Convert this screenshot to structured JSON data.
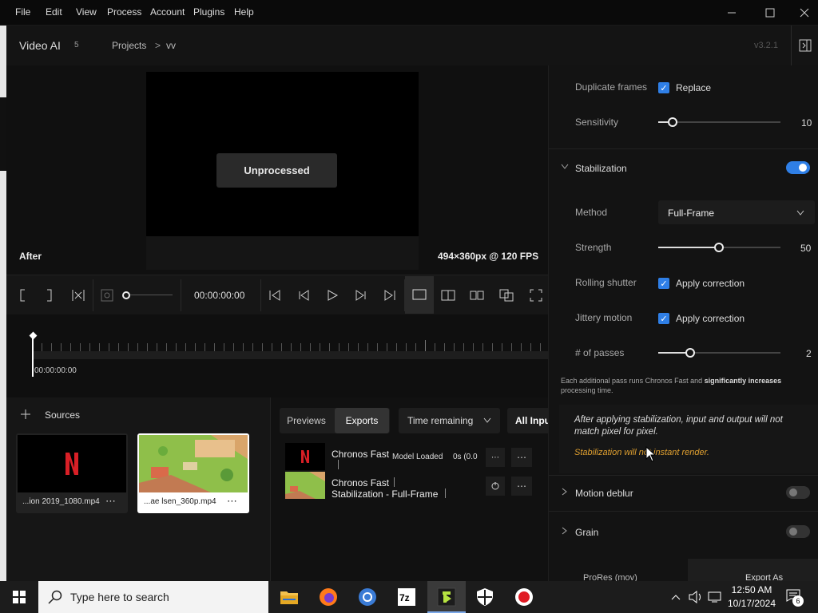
{
  "menu": {
    "items": [
      "File",
      "Edit",
      "View",
      "Process",
      "Account",
      "Plugins",
      "Help"
    ]
  },
  "header": {
    "app_name": "Video AI",
    "app_badge": "5",
    "breadcrumb_projects": "Projects",
    "breadcrumb_sep": ">",
    "breadcrumb_current": "vv",
    "version": "v3.2.1"
  },
  "preview": {
    "unprocessed_label": "Unprocessed",
    "after_label": "After",
    "resolution": "494×360px @ 120 FPS"
  },
  "transport": {
    "timecode": "00:00:00:00"
  },
  "timeline": {
    "timecode": "00:00:00:00"
  },
  "sources": {
    "title": "Sources",
    "items": [
      {
        "name": "...ion 2019_1080.mp4",
        "thumb": "netflix-logo"
      },
      {
        "name": "...ae lsen_360p.mp4",
        "thumb": "game-scene"
      }
    ]
  },
  "exports_panel": {
    "tabs": [
      "Previews",
      "Exports"
    ],
    "active_tab": "Exports",
    "sort_select": "Time remaining",
    "filter_label": "All Inpu",
    "rows": [
      {
        "title": "Chronos Fast",
        "status": "Model Loaded",
        "time": "0s (0.0",
        "sub": ""
      },
      {
        "title": "Chronos Fast",
        "status": "",
        "time": "",
        "sub": "Stabilization - Full-Frame"
      }
    ]
  },
  "settings": {
    "duplicate_frames": {
      "label": "Duplicate frames",
      "option": "Replace",
      "checked": true
    },
    "sensitivity": {
      "label": "Sensitivity",
      "value": "10",
      "fraction": 0.12
    },
    "stabilization": {
      "label": "Stabilization",
      "enabled": true
    },
    "method": {
      "label": "Method",
      "value": "Full-Frame"
    },
    "strength": {
      "label": "Strength",
      "value": "50",
      "fraction": 0.5
    },
    "rolling_shutter": {
      "label": "Rolling shutter",
      "option": "Apply correction",
      "checked": true
    },
    "jittery_motion": {
      "label": "Jittery motion",
      "option": "Apply correction",
      "checked": true
    },
    "passes": {
      "label": "# of passes",
      "value": "2",
      "fraction": 0.27
    },
    "passes_note_1": "Each additional pass runs Chronos Fast and ",
    "passes_note_bold": "significantly increases",
    "passes_note_2": "processing time.",
    "stab_info": "After applying stabilization, input and output will not match pixel for pixel.",
    "stab_warning": "Stabilization will not instant render.",
    "motion_deblur": {
      "label": "Motion deblur",
      "enabled": false
    },
    "grain": {
      "label": "Grain",
      "enabled": false
    },
    "export_format": "ProRes (mov)",
    "export_as": "Export As"
  },
  "taskbar": {
    "search_placeholder": "Type here to search",
    "time": "12:50 AM",
    "date": "10/17/2024",
    "notification_count": "6"
  },
  "colors": {
    "accent": "#2f7fe6",
    "warning": "#e0a030"
  }
}
